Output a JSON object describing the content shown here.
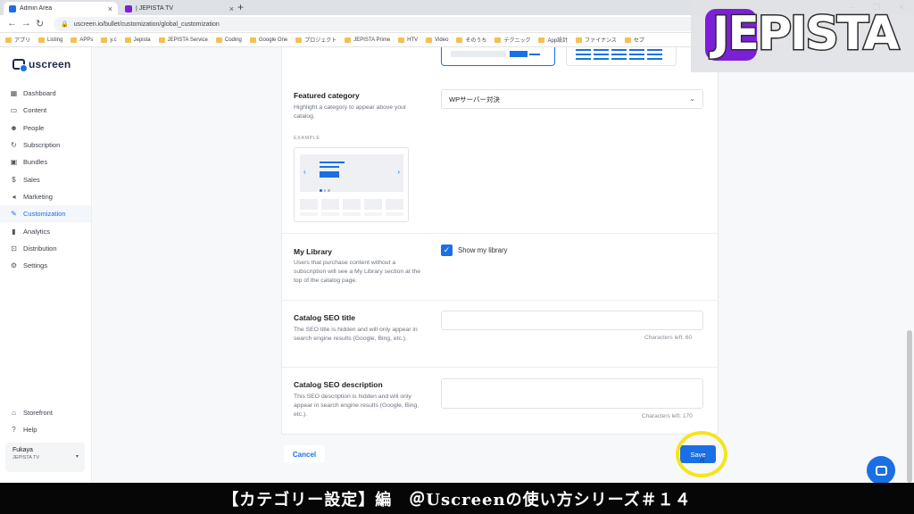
{
  "browser": {
    "tabs": [
      {
        "title": "Admin Area",
        "active": true
      },
      {
        "title": "| JEPISTA TV",
        "active": false
      }
    ],
    "url": "uscreen.io/bullet/customization/global_customization",
    "bookmarks": [
      "アプリ",
      "Listing",
      "APPs",
      "y.c",
      "Jepista",
      "JEPISTA Service",
      "Coding",
      "Google One",
      "プロジェクト",
      "JEPISTA Prime",
      "HTV",
      "Video",
      "そのうち",
      "テクニック",
      "App設計",
      "ファイナンス",
      "セブ"
    ]
  },
  "sidebar": {
    "brand": "uscreen",
    "items": [
      {
        "label": "Dashboard",
        "icon": "dashboard-icon",
        "glyph": "▦"
      },
      {
        "label": "Content",
        "icon": "content-icon",
        "glyph": "▭"
      },
      {
        "label": "People",
        "icon": "people-icon",
        "glyph": "☻"
      },
      {
        "label": "Subscription",
        "icon": "subscription-icon",
        "glyph": "↻"
      },
      {
        "label": "Bundles",
        "icon": "bundles-icon",
        "glyph": "▣"
      },
      {
        "label": "Sales",
        "icon": "sales-icon",
        "glyph": "$"
      },
      {
        "label": "Marketing",
        "icon": "marketing-icon",
        "glyph": "◂"
      },
      {
        "label": "Customization",
        "icon": "customization-icon",
        "glyph": "✎",
        "active": true
      },
      {
        "label": "Analytics",
        "icon": "analytics-icon",
        "glyph": "▮"
      },
      {
        "label": "Distribution",
        "icon": "distribution-icon",
        "glyph": "⊡"
      },
      {
        "label": "Settings",
        "icon": "settings-icon",
        "glyph": "⚙"
      }
    ],
    "bottom_items": [
      {
        "label": "Storefront",
        "icon": "storefront-icon",
        "glyph": "⌂"
      },
      {
        "label": "Help",
        "icon": "help-icon",
        "glyph": "?"
      }
    ],
    "account": {
      "name": "Fukaya",
      "site": "JEPISTA TV"
    }
  },
  "featured_category": {
    "title": "Featured category",
    "description": "Highlight a category to appear above your catalog.",
    "selected": "WPサーバー対決",
    "example_label": "EXAMPLE"
  },
  "my_library": {
    "title": "My Library",
    "description": "Users that purchase content without a subscription will see a My Library section at the top of the catalog page.",
    "checkbox_label": "Show my library",
    "checked": true
  },
  "seo_title": {
    "title": "Catalog SEO title",
    "description": "The SEO title is hidden and will only appear in search engine results (Google, Bing, etc.).",
    "value": "",
    "chars_left": "Characters left: 60"
  },
  "seo_description": {
    "title": "Catalog SEO description",
    "description": "This SEO description is hidden and will only appear in search engine results (Google, Bing, etc.).",
    "value": "",
    "chars_left": "Characters left: 170"
  },
  "actions": {
    "cancel": "Cancel",
    "save": "Save"
  },
  "overlay": {
    "logo_text": "JEPISTA",
    "caption": "【カテゴリー設定】編　＠Uscreenの使い方シリーズ＃１４"
  },
  "colors": {
    "accent": "#1b6fe4",
    "highlight": "#f6e51a",
    "brand_purple": "#7d1fd8"
  }
}
